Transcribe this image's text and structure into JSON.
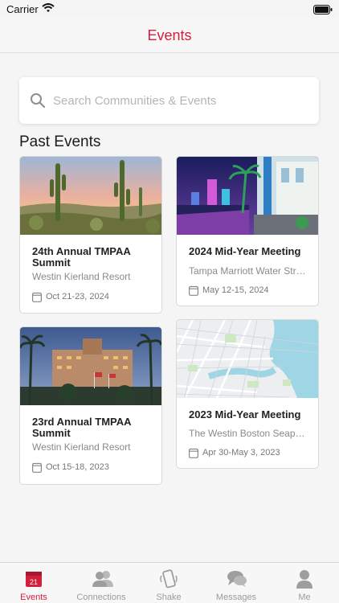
{
  "status_bar": {
    "carrier": "Carrier"
  },
  "nav": {
    "title": "Events"
  },
  "search": {
    "placeholder": "Search Communities & Events"
  },
  "section": {
    "title": "Past Events"
  },
  "events": [
    {
      "title": "24th Annual TMPAA Summit",
      "venue": "Westin Kierland Resort",
      "dates": "Oct 21-23, 2024"
    },
    {
      "title": "2024 Mid-Year Meeting",
      "venue": "Tampa Marriott Water Street",
      "dates": "May 12-15, 2024"
    },
    {
      "title": "23rd Annual TMPAA Summit",
      "venue": "Westin Kierland Resort",
      "dates": "Oct 15-18, 2023"
    },
    {
      "title": "2023 Mid-Year Meeting",
      "venue": "The Westin Boston Seaport District",
      "dates": "Apr 30-May 3, 2023"
    }
  ],
  "tabs": [
    {
      "label": "Events",
      "icon": "calendar-icon",
      "badge": "21",
      "active": true
    },
    {
      "label": "Connections",
      "icon": "people-icon"
    },
    {
      "label": "Shake",
      "icon": "phone-shake-icon"
    },
    {
      "label": "Messages",
      "icon": "chat-bubbles-icon"
    },
    {
      "label": "Me",
      "icon": "person-icon"
    }
  ],
  "colors": {
    "accent": "#d21f3c",
    "inactive": "#9b9b9b",
    "background": "#f5f5f6"
  }
}
